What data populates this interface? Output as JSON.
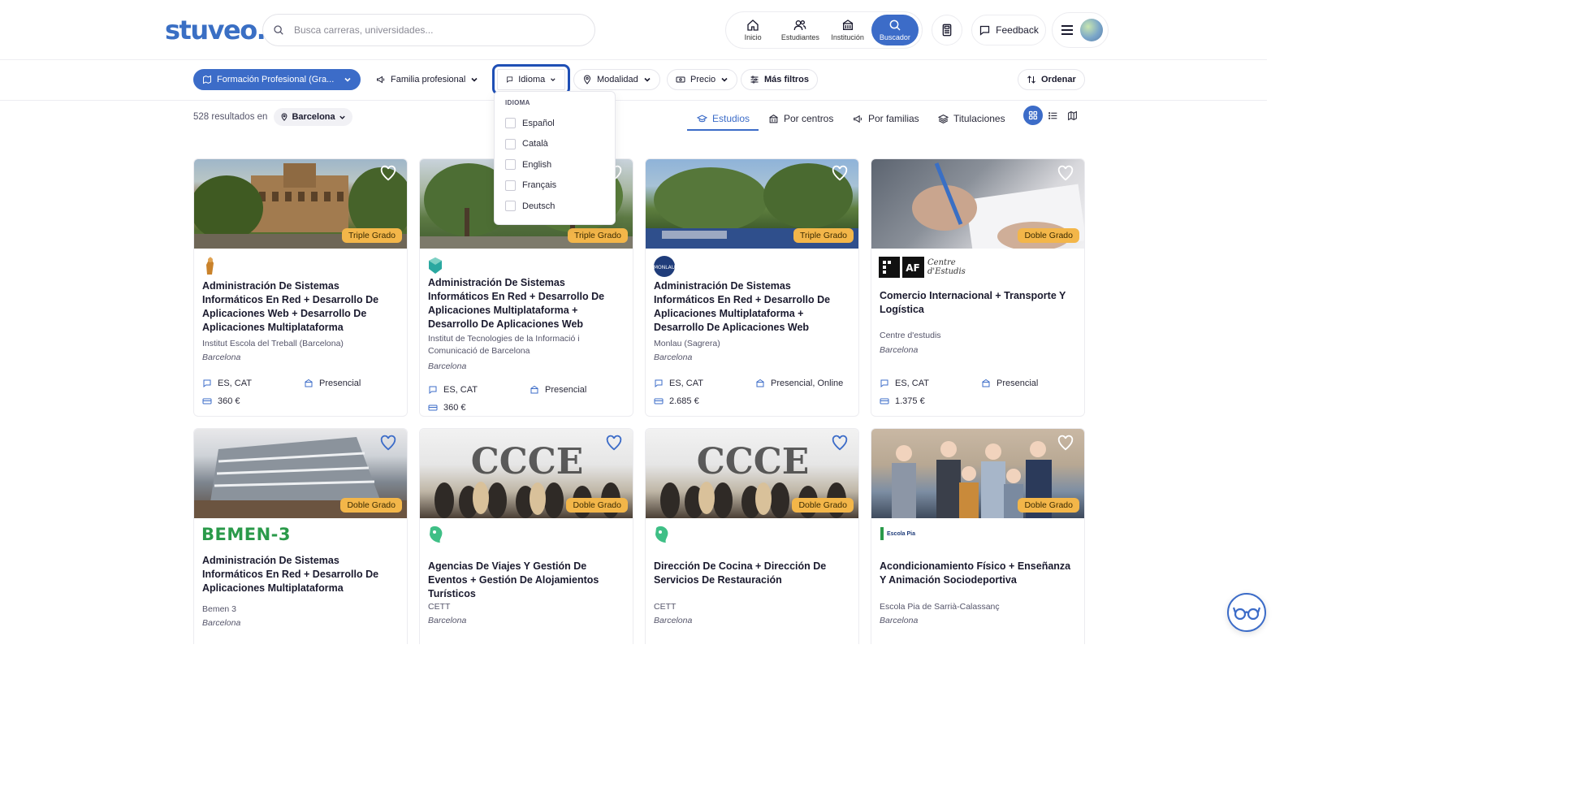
{
  "brand": {
    "logo_text": "stuveo.",
    "color": "#3a6fc4"
  },
  "search": {
    "placeholder": "Busca carreras, universidades..."
  },
  "nav": {
    "items": [
      {
        "label": "Inicio",
        "icon": "home-icon"
      },
      {
        "label": "Estudiantes",
        "icon": "students-icon"
      },
      {
        "label": "Institución",
        "icon": "institution-icon"
      },
      {
        "label": "Buscador",
        "icon": "search-icon",
        "active": true
      }
    ],
    "feedback_label": "Feedback"
  },
  "filters": {
    "study_type": "Formación Profesional (Gra...",
    "family": "Familia profesional",
    "language": "Idioma",
    "modality": "Modalidad",
    "price": "Precio",
    "more": "Más filtros",
    "order": "Ordenar"
  },
  "language_dropdown": {
    "title": "IDIOMA",
    "options": [
      "Español",
      "Català",
      "English",
      "Français",
      "Deutsch"
    ],
    "selected": []
  },
  "results": {
    "count_text": "528 resultados en",
    "location": "Barcelona"
  },
  "tabs": [
    {
      "label": "Estudios",
      "active": true
    },
    {
      "label": "Por centros"
    },
    {
      "label": "Por familias"
    },
    {
      "label": "Titulaciones"
    }
  ],
  "accent_color": "#3c6cc8",
  "badge_color": "#f3b649",
  "cards": [
    {
      "badge": "Triple Grado",
      "title": "Administración De Sistemas Informáticos En Red + Desarrollo De Aplicaciones Web + Desarrollo De Aplicaciones Multiplataforma",
      "institution": "Institut Escola del Treball (Barcelona)",
      "city": "Barcelona",
      "languages": "ES, CAT",
      "modality": "Presencial",
      "price": "360 €",
      "logo": "institut-treball-logo"
    },
    {
      "badge": "Triple Grado",
      "title": "Administración De Sistemas Informáticos En Red + Desarrollo De Aplicaciones Multiplataforma + Desarrollo De Aplicaciones Web",
      "institution": "Institut de Tecnologies de la Informació i Comunicació de Barcelona",
      "city": "Barcelona",
      "languages": "ES, CAT",
      "modality": "Presencial",
      "price": "360 €",
      "logo": "itic-logo"
    },
    {
      "badge": "Triple Grado",
      "title": "Administración De Sistemas Informáticos En Red + Desarrollo De Aplicaciones Multiplataforma + Desarrollo De Aplicaciones Web",
      "institution": "Monlau (Sagrera)",
      "city": "Barcelona",
      "languages": "ES, CAT",
      "modality": "Presencial, Online",
      "price": "2.685 €",
      "logo": "monlau-logo"
    },
    {
      "badge": "Doble Grado",
      "title": "Comercio Internacional + Transporte Y Logística",
      "institution": "Centre d'estudis",
      "city": "Barcelona",
      "languages": "ES, CAT",
      "modality": "Presencial",
      "price": "1.375 €",
      "logo": "af-centre-logo",
      "logo_text": "Centre d'Estudis"
    },
    {
      "badge": "Doble Grado",
      "title": "Administración De Sistemas Informáticos En Red + Desarrollo De Aplicaciones Multiplataforma",
      "institution": "Bemen 3",
      "city": "Barcelona",
      "logo": "bemen3-logo",
      "logo_text": "BEMEN-3"
    },
    {
      "badge": "Doble Grado",
      "title": "Agencias De Viajes Y Gestión De Eventos + Gestión De Alojamientos Turísticos",
      "institution": "CETT",
      "city": "Barcelona",
      "logo": "cett-logo"
    },
    {
      "badge": "Doble Grado",
      "title": "Dirección De Cocina + Dirección De Servicios De Restauración",
      "institution": "CETT",
      "city": "Barcelona",
      "logo": "cett-logo"
    },
    {
      "badge": "Doble Grado",
      "title": "Acondicionamiento Físico + Enseñanza Y Animación Sociodeportiva",
      "institution": "Escola Pia de Sarrià-Calassanç",
      "city": "Barcelona",
      "logo": "escola-pia-logo",
      "logo_text": "Escola Pia"
    }
  ]
}
